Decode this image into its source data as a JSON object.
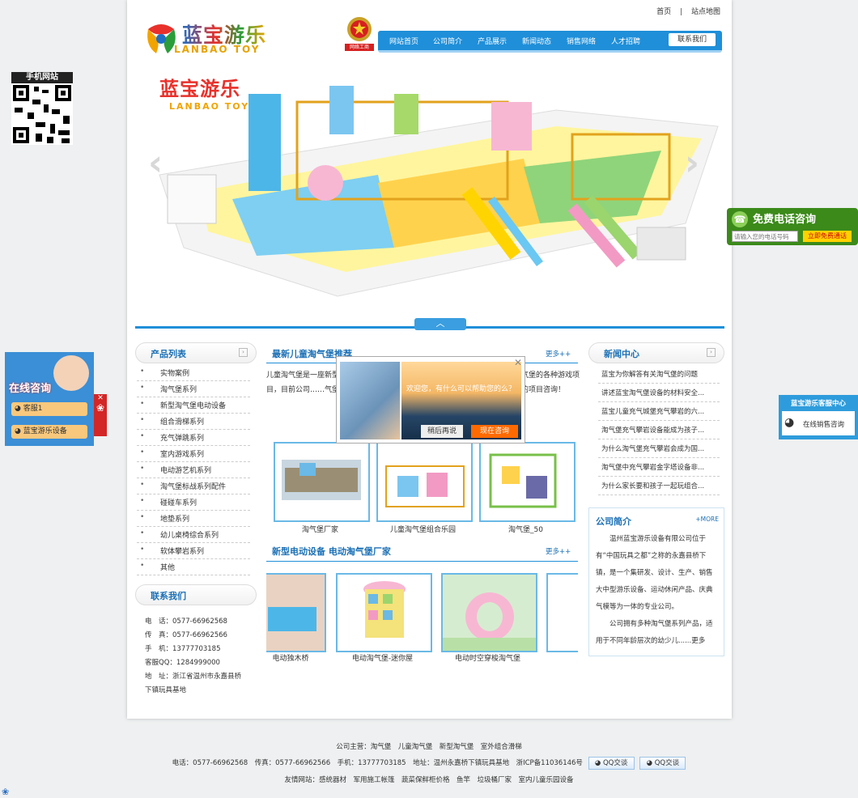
{
  "header": {
    "top_links": [
      "首页",
      "|",
      "站点地图"
    ],
    "logo_cn": "蓝宝游乐",
    "logo_en": "LANBAO TOY",
    "badge_text": "网络工商",
    "nav": [
      "网站首页",
      "公司简介",
      "产品展示",
      "新闻动态",
      "销售网络",
      "人才招聘"
    ],
    "nav_contact": "联系我们"
  },
  "banner": {
    "logo_cn": "蓝宝游乐",
    "logo_en": "LANBAO TOY",
    "prev_icon": "chevron-left-icon",
    "next_icon": "chevron-right-icon",
    "toggle_icon": "chevron-up-icon"
  },
  "products": {
    "title": "产品列表",
    "items": [
      "实物案例",
      "淘气堡系列",
      "新型淘气堡电动设备",
      "组合滑梯系列",
      "充气弹跳系列",
      "室内游戏系列",
      "电动游艺机系列",
      "淘气堡标战系列配件",
      "碰碰车系列",
      "地垫系列",
      "幼儿桌椅综合系列",
      "软体攀岩系列",
      "其他"
    ]
  },
  "contact": {
    "title": "联系我们",
    "lines": [
      "电　话：0577-66962568",
      "传　真：0577-66962566",
      "手　机：13777703185",
      "客服QQ：1284999000",
      "地　址：浙江省温州市永嘉县桥",
      "下镇玩具基地"
    ]
  },
  "recommend": {
    "title": "最新儿童淘气堡推荐",
    "more": "更多++",
    "intro": "儿童淘气堡是一座新型的……外，还是不规则的场地，均能安装，包……几代淘气堡的各种游戏项目，目前公司……气堡系列，同时又新增了空中娇车等……们可以为您提供详细的项目咨询！",
    "captions": [
      "淘气堡厂家",
      "儿童淘气堡组合乐园",
      "淘气堡_50"
    ]
  },
  "electric": {
    "title": "新型电动设备  电动淘气堡厂家",
    "more": "更多++",
    "captions": [
      "电动独木桥",
      "电动淘气堡-迷你屋",
      "电动时空穿梭淘气堡"
    ]
  },
  "popup": {
    "text": "欢迎您，有什么可以帮助您的么？",
    "later": "稍后再说",
    "now": "现在咨询"
  },
  "news": {
    "title": "新闻中心",
    "items": [
      "蓝宝为你解答有关淘气堡的问题",
      "讲述蓝宝淘气堡设备的材料安全...",
      "蓝宝儿童充气城堡充气攀岩的六...",
      "淘气堡充气攀岩设备能成为孩子...",
      "为什么淘气堡充气攀岩会成为国...",
      "淘气堡中充气攀岩金字塔设备非...",
      "为什么家长要和孩子一起玩组合..."
    ]
  },
  "about": {
    "title": "公司简介",
    "more": "+MORE",
    "p1": "温州蓝宝游乐设备有限公司位于有“中国玩具之都”之称的永嘉县桥下镇，是一个集研发、设计、生产、销售大中型游乐设备、运动休闲产品、庆典气模等为一体的专业公司。",
    "p2": "公司拥有多种淘气堡系列产品，适用于不同年龄层次的幼少儿......更多"
  },
  "footer": {
    "line1": "公司主营：淘气堡　儿童淘气堡　新型淘气堡　室外组合滑梯",
    "line2": "电话：0577-66962568　传真：0577-66962566　手机：13777703185　地址：温州永嘉桥下镇玩具基地　浙ICP备11036146号",
    "qq1": "QQ交谈",
    "qq2": "QQ交谈",
    "line3": "友情网站：感统器材　军用施工帐篷　蔬菜保鲜柜价格　鱼竿　垃圾桶厂家　室内儿童乐园设备"
  },
  "float": {
    "qr_title": "手机网站",
    "online_title": "在线咨询",
    "online_btn1": "客服1",
    "online_btn2": "蓝宝游乐设备",
    "phone_title": "免费电话咨询",
    "phone_placeholder": "请输入您的电话号码",
    "phone_btn": "立即免费通话",
    "svc_title": "蓝宝游乐客服中心",
    "svc_btn": "在线销售咨询"
  },
  "colors": {
    "brand_blue": "#1f8fd9",
    "title_blue": "#1b70b6",
    "accent_orange": "#ff6a00"
  }
}
